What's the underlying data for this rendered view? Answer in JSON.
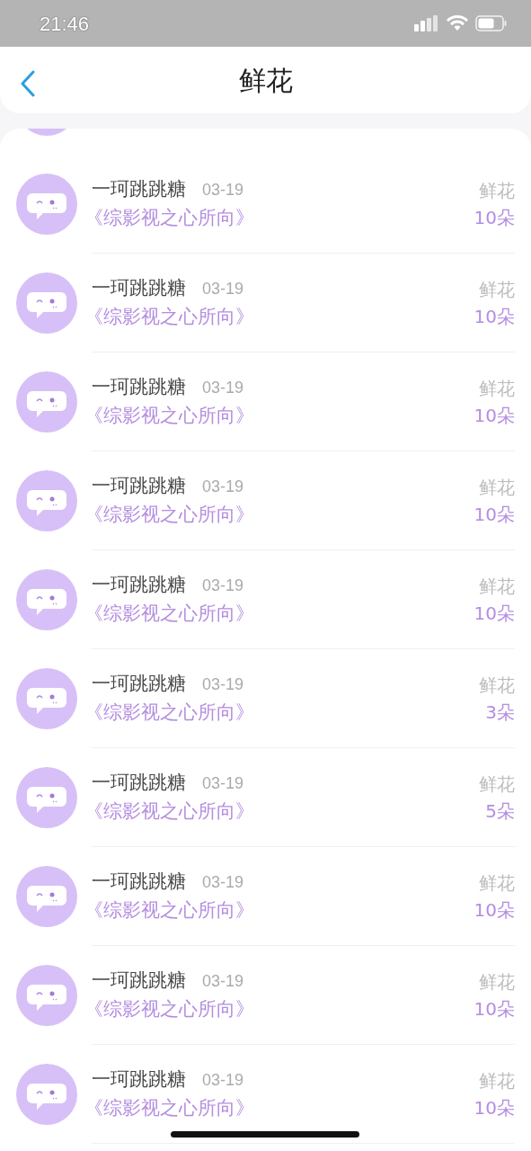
{
  "status_bar": {
    "time": "21:46"
  },
  "header": {
    "title": "鲜花"
  },
  "records": [
    {
      "name": "一珂跳跳糖",
      "date": "03-19",
      "book": "《综影视之心所向》",
      "gift": "鲜花",
      "count": "10朵"
    },
    {
      "name": "一珂跳跳糖",
      "date": "03-19",
      "book": "《综影视之心所向》",
      "gift": "鲜花",
      "count": "10朵"
    },
    {
      "name": "一珂跳跳糖",
      "date": "03-19",
      "book": "《综影视之心所向》",
      "gift": "鲜花",
      "count": "10朵"
    },
    {
      "name": "一珂跳跳糖",
      "date": "03-19",
      "book": "《综影视之心所向》",
      "gift": "鲜花",
      "count": "10朵"
    },
    {
      "name": "一珂跳跳糖",
      "date": "03-19",
      "book": "《综影视之心所向》",
      "gift": "鲜花",
      "count": "10朵"
    },
    {
      "name": "一珂跳跳糖",
      "date": "03-19",
      "book": "《综影视之心所向》",
      "gift": "鲜花",
      "count": "3朵"
    },
    {
      "name": "一珂跳跳糖",
      "date": "03-19",
      "book": "《综影视之心所向》",
      "gift": "鲜花",
      "count": "5朵"
    },
    {
      "name": "一珂跳跳糖",
      "date": "03-19",
      "book": "《综影视之心所向》",
      "gift": "鲜花",
      "count": "10朵"
    },
    {
      "name": "一珂跳跳糖",
      "date": "03-19",
      "book": "《综影视之心所向》",
      "gift": "鲜花",
      "count": "10朵"
    },
    {
      "name": "一珂跳跳糖",
      "date": "03-19",
      "book": "《综影视之心所向》",
      "gift": "鲜花",
      "count": "10朵"
    }
  ]
}
